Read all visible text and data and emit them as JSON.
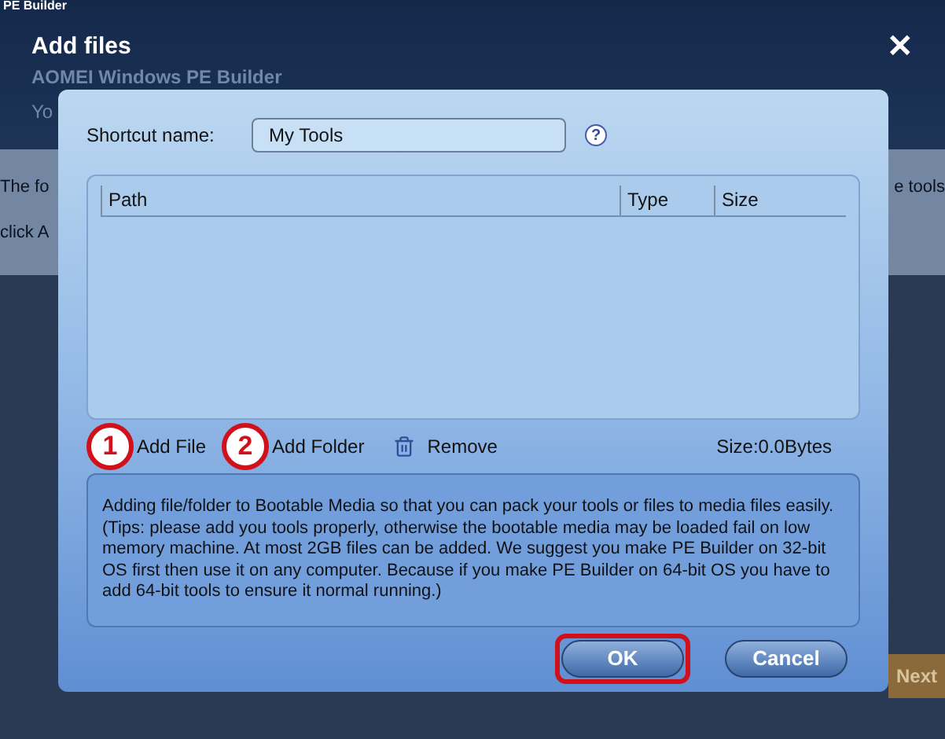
{
  "background": {
    "app_title": "PE Builder",
    "left_text": [
      "The fo",
      "click A"
    ],
    "right_text": "e tools",
    "next_button": "Next"
  },
  "dialog": {
    "title": "Add files",
    "close": "✕",
    "behind_title": "AOMEI Windows PE Builder",
    "behind_subtitle": "Yo",
    "shortcut": {
      "label": "Shortcut name:",
      "value": "My Tools",
      "help": "?"
    },
    "table": {
      "columns": [
        "Path",
        "Type",
        "Size"
      ]
    },
    "actions": [
      {
        "kind": "add",
        "label": "Add File",
        "annotation": "1"
      },
      {
        "kind": "add",
        "label": "Add Folder",
        "annotation": "2"
      },
      {
        "kind": "remove",
        "label": "Remove"
      }
    ],
    "total_size": "Size:0.0Bytes",
    "description": "Adding file/folder to Bootable Media so that you can pack your tools or files to media files easily.(Tips: please add you tools properly, otherwise the bootable media may be loaded fail on low memory machine. At most 2GB files can be added. We suggest you make PE Builder on 32-bit OS first then use it on any computer. Because if you make PE Builder on 64-bit OS you have to add 64-bit tools to ensure it normal running.)",
    "buttons": [
      {
        "label": "OK",
        "highlighted": true
      },
      {
        "label": "Cancel",
        "highlighted": false
      }
    ]
  }
}
